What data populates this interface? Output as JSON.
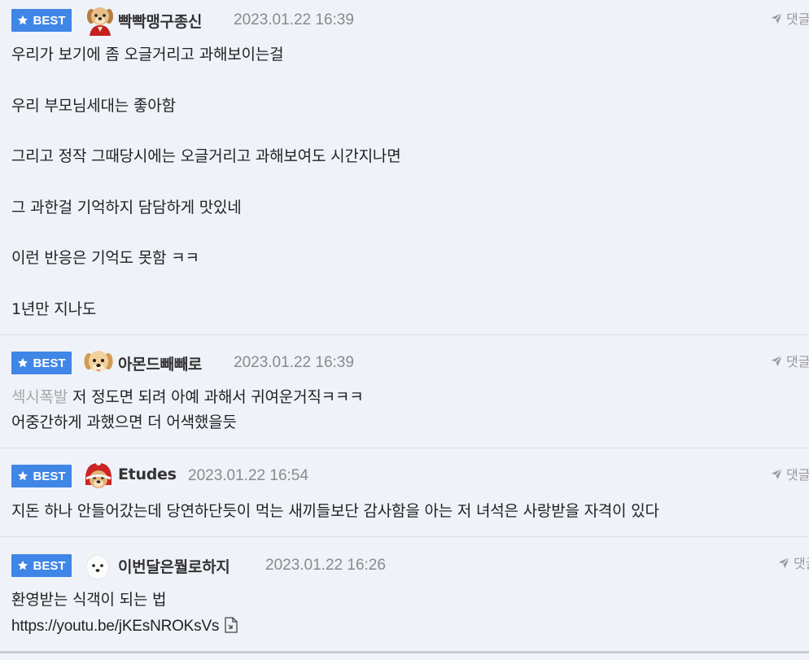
{
  "badge_label": "BEST",
  "reply_label": "댓글",
  "comments": [
    {
      "nickname": "빡빡맹구종신",
      "avatar": "puppy-in-red-coat",
      "timestamp": "2023.01.22 16:39",
      "lines": [
        "우리가 보기에 좀 오글거리고 과해보이는걸",
        "우리 부모님세대는 좋아함",
        "그리고 정작 그때당시에는 오글거리고 과해보여도 시간지나면",
        "그 과한걸 기억하지 담담하게 맛있네",
        "이런 반응은 기억도 못함 ㅋㅋ",
        "1년만 지나도"
      ]
    },
    {
      "nickname": "아몬드빼빼로",
      "avatar": "golden-puppy",
      "timestamp": "2023.01.22 16:39",
      "mention": "섹시폭발",
      "lines": [
        "저 정도면 되려 아예 과해서 귀여운거직ㅋㅋㅋ",
        "어중간하게 과했으면 더 어색했을듯"
      ]
    },
    {
      "nickname": "Etudes",
      "avatar": "puppy-in-red-hood",
      "timestamp": "2023.01.22 16:54",
      "lines": [
        "지돈 하나 안들어갔는데 당연하단듯이 먹는 새끼들보단 감사함을 아는 저 녀석은 사랑받을 자격이 있다"
      ]
    },
    {
      "nickname": "이번달은뭘로하지",
      "avatar": "white-puppy",
      "timestamp": "2023.01.22 16:26",
      "lines": [
        "환영받는 식객이 되는 법"
      ],
      "link": "https://youtu.be/jKEsNROKsVs"
    }
  ],
  "colors": {
    "background": "#eff2f8",
    "badge": "#3f86e6",
    "divider": "#dadde3",
    "mention": "#a5a5a5",
    "timestamp": "#8a8a8a"
  },
  "icons": {
    "badge": "star-icon",
    "reply": "send-arrow-icon",
    "link": "open-link-icon"
  }
}
